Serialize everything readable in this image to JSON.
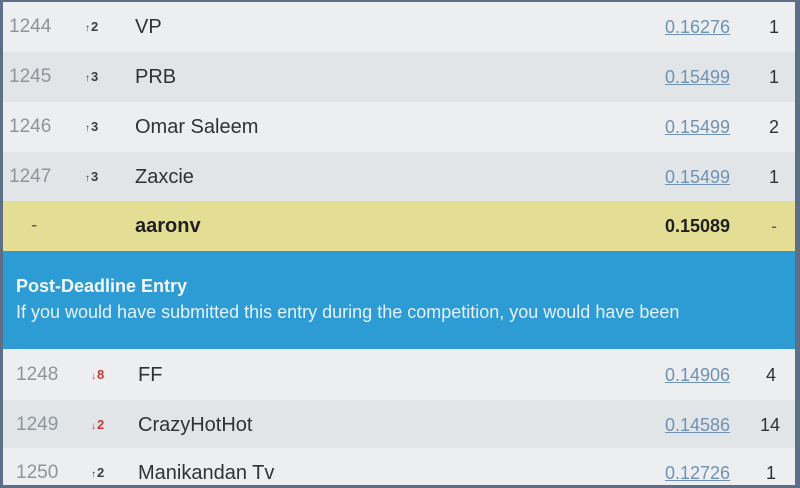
{
  "leaderboard": {
    "rows_top": [
      {
        "rank": "1244",
        "delta_dir": "up",
        "delta": "2",
        "name": "VP",
        "score": "0.16276",
        "entries": "1"
      },
      {
        "rank": "1245",
        "delta_dir": "up",
        "delta": "3",
        "name": "PRB",
        "score": "0.15499",
        "entries": "1"
      },
      {
        "rank": "1246",
        "delta_dir": "up",
        "delta": "3",
        "name": "Omar Saleem",
        "score": "0.15499",
        "entries": "2"
      },
      {
        "rank": "1247",
        "delta_dir": "up",
        "delta": "3",
        "name": "Zaxcie",
        "score": "0.15499",
        "entries": "1"
      }
    ],
    "highlight": {
      "rank": "-",
      "name": "aaronv",
      "score": "0.15089",
      "entries": "-"
    },
    "banner": {
      "title": "Post-Deadline Entry",
      "text": "If you would have submitted this entry during the competition, you would have been"
    },
    "rows_bottom": [
      {
        "rank": "1248",
        "delta_dir": "down",
        "delta": "8",
        "name": "FF",
        "score": "0.14906",
        "entries": "4"
      },
      {
        "rank": "1249",
        "delta_dir": "down",
        "delta": "2",
        "name": "CrazyHotHot",
        "score": "0.14586",
        "entries": "14"
      },
      {
        "rank": "1250",
        "delta_dir": "up",
        "delta": "2",
        "name": "Manikandan Tv",
        "score": "0.12726",
        "entries": "1"
      }
    ],
    "arrows": {
      "up": "↑",
      "down": "↓"
    },
    "colors": {
      "highlight": "#e4de95",
      "banner": "#2d9bd4",
      "link": "#6e92b4",
      "down": "#c63a33"
    }
  }
}
